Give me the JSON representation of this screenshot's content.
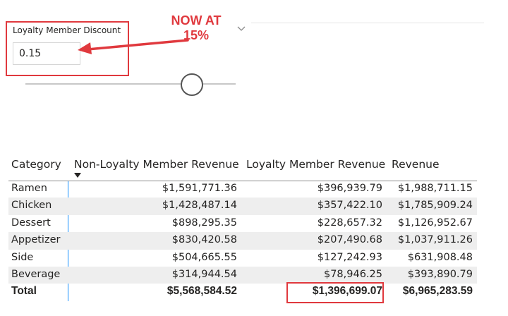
{
  "slicer": {
    "title": "Loyalty Member Discount",
    "value": "0.15",
    "slider_fraction": 0.15
  },
  "annotation": {
    "line1": "NOW AT",
    "line2": "15%"
  },
  "colors": {
    "highlight": "#e0393e",
    "column_divider": "#118dff",
    "alt_row": "#eeeeee"
  },
  "table": {
    "headers": [
      "Category",
      "Non-Loyalty Member Revenue",
      "Loyalty Member Revenue",
      "Revenue"
    ],
    "rows": [
      {
        "category": "Ramen",
        "non_loyalty": "$1,591,771.36",
        "loyalty": "$396,939.79",
        "revenue": "$1,988,711.15"
      },
      {
        "category": "Chicken",
        "non_loyalty": "$1,428,487.14",
        "loyalty": "$357,422.10",
        "revenue": "$1,785,909.24"
      },
      {
        "category": "Dessert",
        "non_loyalty": "$898,295.35",
        "loyalty": "$228,657.32",
        "revenue": "$1,126,952.67"
      },
      {
        "category": "Appetizer",
        "non_loyalty": "$830,420.58",
        "loyalty": "$207,490.68",
        "revenue": "$1,037,911.26"
      },
      {
        "category": "Side",
        "non_loyalty": "$504,665.55",
        "loyalty": "$127,242.93",
        "revenue": "$631,908.48"
      },
      {
        "category": "Beverage",
        "non_loyalty": "$314,944.54",
        "loyalty": "$78,946.25",
        "revenue": "$393,890.79"
      }
    ],
    "total": {
      "label": "Total",
      "non_loyalty": "$5,568,584.52",
      "loyalty": "$1,396,699.07",
      "revenue": "$6,965,283.59"
    }
  }
}
